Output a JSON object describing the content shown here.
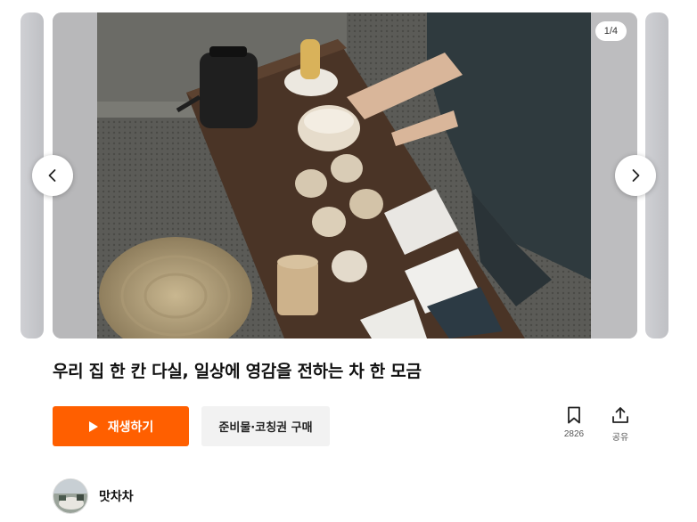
{
  "carousel": {
    "counter": "1/4",
    "current_slide": 1,
    "total_slides": 4,
    "image_description_icon": "tea-ceremony-photo",
    "prev_icon": "chevron-left-icon",
    "next_icon": "chevron-right-icon"
  },
  "content": {
    "title": "우리 집 한 칸 다실, 일상에 영감을 전하는 차 한 모금"
  },
  "actions": {
    "play_label": "재생하기",
    "play_icon": "play-icon",
    "buy_label": "준비물·코칭권 구매",
    "bookmark_count": "2826",
    "bookmark_icon": "bookmark-icon",
    "share_label": "공유",
    "share_icon": "share-icon"
  },
  "author": {
    "name": "맛차차",
    "avatar_icon": "avatar"
  },
  "colors": {
    "accent": "#ff5f00",
    "secondary_button_bg": "#f2f2f2"
  }
}
